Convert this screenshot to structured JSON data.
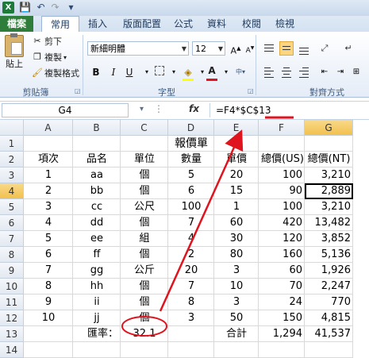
{
  "quick_access": {
    "logo": "X",
    "save_icon": "💾",
    "undo_icon": "↶",
    "redo_icon": "↷",
    "more_icon": "▾"
  },
  "tabs": [
    "檔案",
    "常用",
    "插入",
    "版面配置",
    "公式",
    "資料",
    "校閱",
    "檢視"
  ],
  "ribbon": {
    "clipboard": {
      "paste": "貼上",
      "cut": "剪下",
      "copy": "複製",
      "format_painter": "複製格式",
      "group": "剪貼簿"
    },
    "font": {
      "name": "新細明體",
      "size": "12",
      "bold": "B",
      "italic": "I",
      "underline": "U",
      "grow": "A",
      "shrink": "A",
      "font_color": "A",
      "group": "字型"
    },
    "alignment": {
      "group": "對齊方式"
    }
  },
  "formula_bar": {
    "name_box": "G4",
    "fx": "fx",
    "formula": "=F4*$C$13"
  },
  "columns": [
    "A",
    "B",
    "C",
    "D",
    "E",
    "F",
    "G"
  ],
  "rows": [
    "1",
    "2",
    "3",
    "4",
    "5",
    "6",
    "7",
    "8",
    "9",
    "10",
    "11",
    "12",
    "13",
    "14"
  ],
  "sheet": {
    "title": "報價單",
    "headers": [
      "項次",
      "品名",
      "單位",
      "數量",
      "單價",
      "總價(US)",
      "總價(NT)"
    ],
    "data": [
      [
        "1",
        "aa",
        "個",
        "5",
        "20",
        "100",
        "3,210"
      ],
      [
        "2",
        "bb",
        "個",
        "6",
        "15",
        "90",
        "2,889"
      ],
      [
        "3",
        "cc",
        "公尺",
        "100",
        "1",
        "100",
        "3,210"
      ],
      [
        "4",
        "dd",
        "個",
        "7",
        "60",
        "420",
        "13,482"
      ],
      [
        "5",
        "ee",
        "組",
        "4",
        "30",
        "120",
        "3,852"
      ],
      [
        "6",
        "ff",
        "個",
        "2",
        "80",
        "160",
        "5,136"
      ],
      [
        "7",
        "gg",
        "公斤",
        "20",
        "3",
        "60",
        "1,926"
      ],
      [
        "8",
        "hh",
        "個",
        "7",
        "10",
        "70",
        "2,247"
      ],
      [
        "9",
        "ii",
        "個",
        "8",
        "3",
        "24",
        "770"
      ],
      [
        "10",
        "jj",
        "個",
        "3",
        "50",
        "150",
        "4,815"
      ]
    ],
    "rate_label": "匯率：",
    "rate_value": "32.1",
    "total_label": "合計",
    "total_us": "1,294",
    "total_nt": "41,537"
  },
  "colors": {
    "annotation": "#e0141e",
    "file_tab": "#2f7d3b",
    "selected_header": "#f2c14e"
  }
}
